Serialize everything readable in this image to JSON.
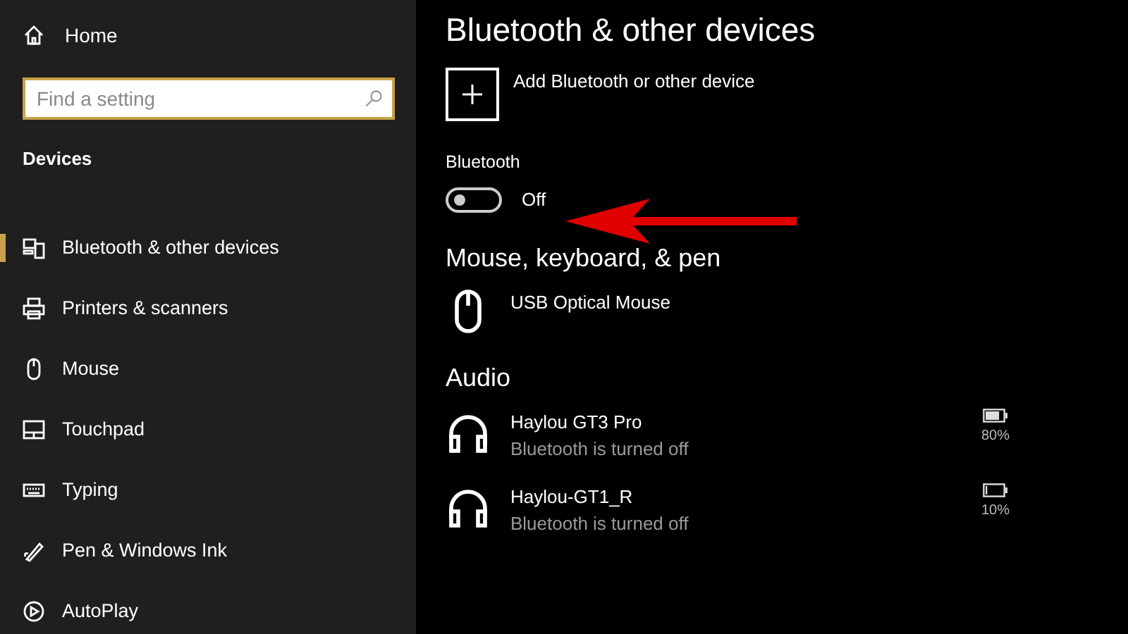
{
  "sidebar": {
    "home": "Home",
    "search": {
      "placeholder": "Find a setting"
    },
    "section": "Devices",
    "items": [
      {
        "label": "Bluetooth & other devices",
        "kind": "bluetooth",
        "selected": true
      },
      {
        "label": "Printers & scanners",
        "kind": "printer",
        "selected": false
      },
      {
        "label": "Mouse",
        "kind": "mouse",
        "selected": false
      },
      {
        "label": "Touchpad",
        "kind": "touchpad",
        "selected": false
      },
      {
        "label": "Typing",
        "kind": "keyboard",
        "selected": false
      },
      {
        "label": "Pen & Windows Ink",
        "kind": "pen",
        "selected": false
      },
      {
        "label": "AutoPlay",
        "kind": "autoplay",
        "selected": false
      }
    ]
  },
  "main": {
    "title": "Bluetooth & other devices",
    "add_button": "Add Bluetooth or other device",
    "bluetooth": {
      "label": "Bluetooth",
      "on": false,
      "state_text": "Off"
    },
    "sections": [
      {
        "heading": "Mouse, keyboard, & pen",
        "devices": [
          {
            "kind": "mouse",
            "name": "USB Optical Mouse"
          }
        ]
      },
      {
        "heading": "Audio",
        "devices": [
          {
            "kind": "headphones",
            "name": "Haylou GT3 Pro",
            "status": "Bluetooth is turned off",
            "battery": "80%"
          },
          {
            "kind": "headphones",
            "name": "Haylou-GT1_R",
            "status": "Bluetooth is turned off",
            "battery": "10%"
          }
        ]
      }
    ]
  }
}
